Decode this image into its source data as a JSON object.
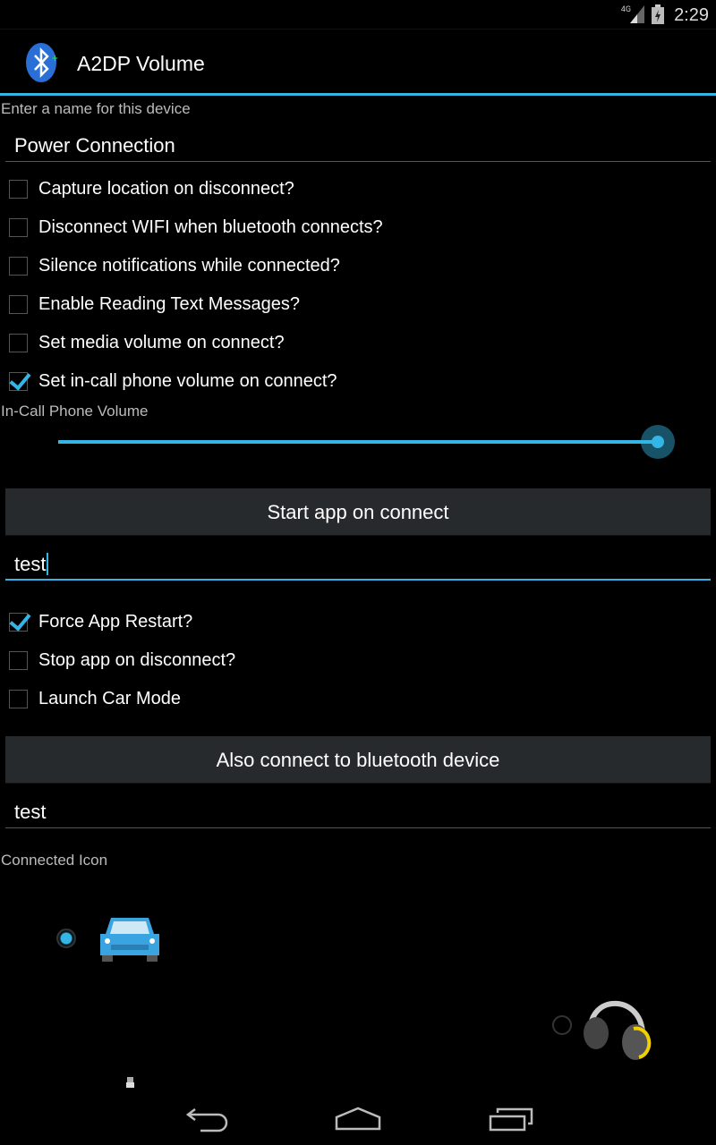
{
  "status_bar": {
    "network": "4G",
    "time": "2:29"
  },
  "action_bar": {
    "title": "A2DP Volume",
    "icon": "bluetooth-icon"
  },
  "device_name": {
    "label": "Enter a name for this device",
    "value": "Power Connection"
  },
  "options": [
    {
      "label": "Capture location on disconnect?",
      "checked": false
    },
    {
      "label": "Disconnect WIFI when bluetooth connects?",
      "checked": false
    },
    {
      "label": "Silence notifications while connected?",
      "checked": false
    },
    {
      "label": "Enable Reading Text Messages?",
      "checked": false
    },
    {
      "label": "Set media volume on connect?",
      "checked": false
    },
    {
      "label": "Set in-call phone volume on connect?",
      "checked": true
    }
  ],
  "volume": {
    "label": "In-Call Phone Volume",
    "value_percent": 100
  },
  "start_app": {
    "button": "Start app on connect",
    "value": "test"
  },
  "app_options": [
    {
      "label": "Force App Restart?",
      "checked": true
    },
    {
      "label": "Stop app on disconnect?",
      "checked": false
    },
    {
      "label": "Launch Car Mode",
      "checked": false
    }
  ],
  "also_connect": {
    "button": "Also connect to bluetooth device",
    "value": "test"
  },
  "connected_icon": {
    "label": "Connected Icon",
    "options": [
      {
        "icon": "car-icon",
        "selected": true
      },
      {
        "icon": "headphones-icon",
        "selected": false
      }
    ]
  },
  "colors": {
    "accent": "#33b5e5",
    "button_bg": "#262a2d"
  }
}
